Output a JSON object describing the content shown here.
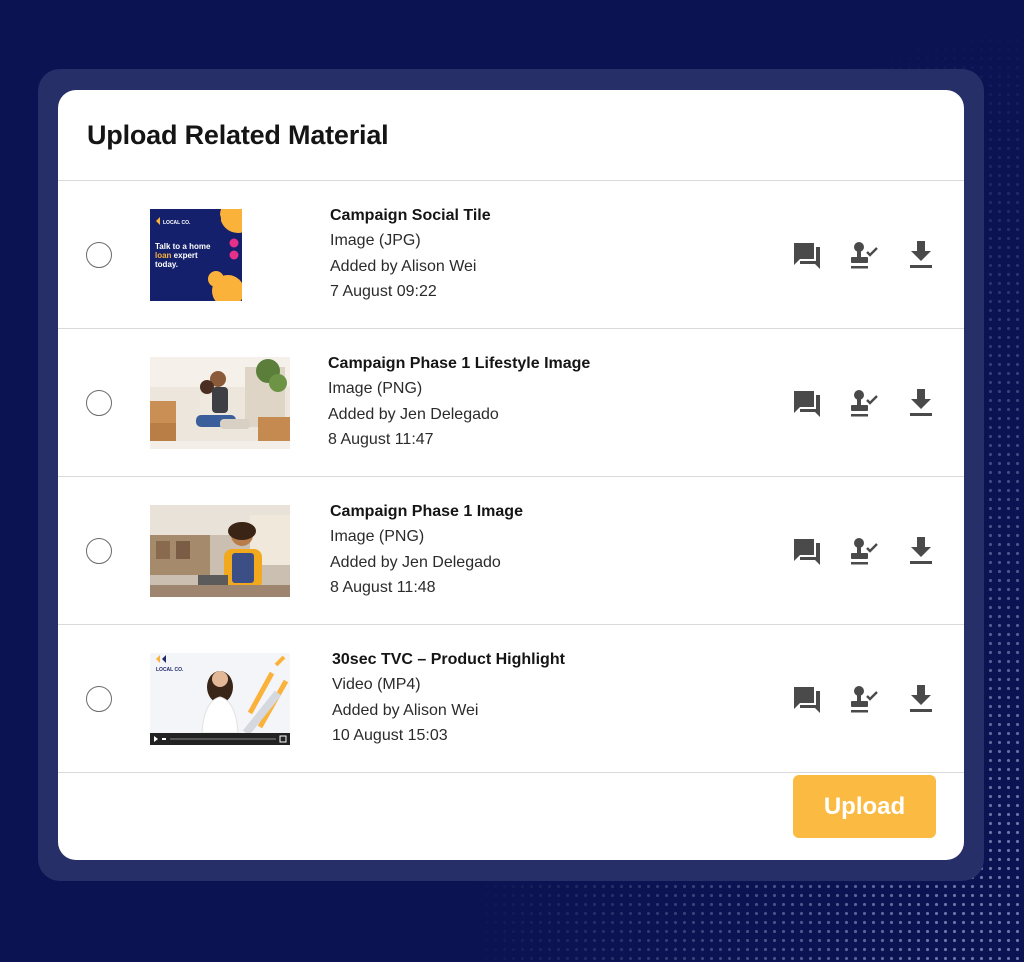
{
  "dialog": {
    "title": "Upload Related Material",
    "upload_label": "Upload"
  },
  "colors": {
    "background": "#0b1352",
    "accent": "#fbba42",
    "icon": "#4a4a4a"
  },
  "items": [
    {
      "name": "Campaign Social Tile",
      "type": "Image (JPG)",
      "added_by": "Added by Alison Wei",
      "date": "7 August 09:22",
      "thumbnail": "social-tile",
      "thumb_brand": "LOCAL CO.",
      "thumb_text_1": "Talk to a home",
      "thumb_text_2a": "loan",
      "thumb_text_2b": " expert",
      "thumb_text_3": "today."
    },
    {
      "name": "Campaign Phase 1 Lifestyle Image",
      "type": "Image (PNG)",
      "added_by": "Added by Jen Delegado",
      "date": "8 August 11:47",
      "thumbnail": "couple-boxes-photo"
    },
    {
      "name": "Campaign Phase 1 Image",
      "type": "Image (PNG)",
      "added_by": "Added by Jen Delegado",
      "date": "8 August 11:48",
      "thumbnail": "woman-cafe-photo"
    },
    {
      "name": "30sec TVC – Product Highlight",
      "type": "Video (MP4)",
      "added_by": "Added by Alison Wei",
      "date": "10 August 15:03",
      "thumbnail": "video-presenter",
      "thumb_brand": "LOCAL CO."
    }
  ],
  "row_actions": [
    "comment-icon",
    "approve-stamp-icon",
    "download-icon"
  ]
}
